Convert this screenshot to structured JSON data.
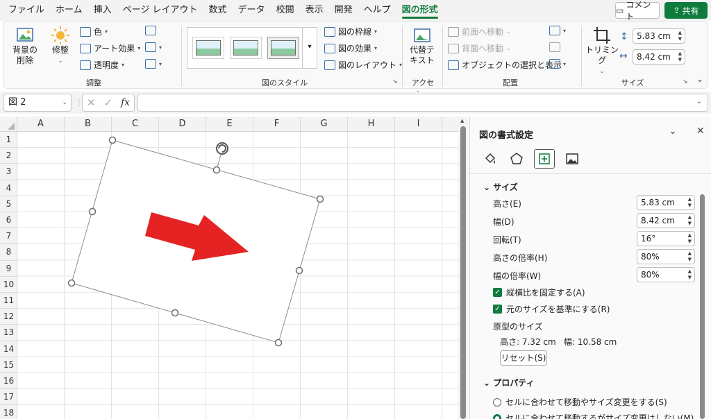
{
  "menu": {
    "tabs": [
      "ファイル",
      "ホーム",
      "挿入",
      "ページ レイアウト",
      "数式",
      "データ",
      "校閲",
      "表示",
      "開発",
      "ヘルプ",
      "図の形式"
    ],
    "active_tab": "図の形式",
    "comment_label": "コメント",
    "share_label": "共有"
  },
  "ribbon": {
    "adjust": {
      "remove_bg": "背景の\n削除",
      "corrections": "修整",
      "color": "色",
      "art_effects": "アート効果",
      "transparency": "透明度",
      "group_label": "調整"
    },
    "styles": {
      "border": "図の枠線",
      "effects": "図の効果",
      "layout": "図のレイアウト",
      "group_label": "図のスタイル"
    },
    "accessibility": {
      "alt_text": "代替テ\nキスト",
      "group_label": "アクセシ…"
    },
    "arrange": {
      "bring_forward": "前面へ移動",
      "send_backward": "背面へ移動",
      "selection_pane": "オブジェクトの選択と表示",
      "group_label": "配置"
    },
    "size": {
      "crop": "トリミング",
      "height": "5.83 cm",
      "width": "8.42 cm",
      "group_label": "サイズ"
    }
  },
  "formula_bar": {
    "name_box": "図 2",
    "fx": "fx",
    "content": ""
  },
  "sheet": {
    "columns": [
      "A",
      "B",
      "C",
      "D",
      "E",
      "F",
      "G",
      "H",
      "I"
    ],
    "rows": [
      "1",
      "2",
      "3",
      "4",
      "5",
      "6",
      "7",
      "8",
      "9",
      "10",
      "11",
      "12",
      "13",
      "14",
      "15",
      "16",
      "17",
      "18"
    ],
    "picture": {
      "rotation_deg": 16,
      "arrow_color": "#e52323"
    }
  },
  "pane": {
    "title": "図の書式設定",
    "size_section": "サイズ",
    "height_label": "高さ(E)",
    "height_value": "5.83 cm",
    "width_label": "幅(D)",
    "width_value": "8.42 cm",
    "rotation_label": "回転(T)",
    "rotation_value": "16°",
    "scale_h_label": "高さの倍率(H)",
    "scale_h_value": "80%",
    "scale_w_label": "幅の倍率(W)",
    "scale_w_value": "80%",
    "lock_aspect": "縦横比を固定する(A)",
    "relative_original": "元のサイズを基準にする(R)",
    "original_size_label": "原型のサイズ",
    "original_height": "高さ:   7.32 cm",
    "original_width": "幅:   10.58 cm",
    "reset_label": "リセット(S)",
    "properties_section": "プロパティ",
    "prop_option1": "セルに合わせて移動やサイズ変更をする(S)",
    "prop_option2": "セルに合わせて移動するがサイズ変更はしない(M)"
  },
  "colors": {
    "accent": "#0f7b3c",
    "arrow": "#e52323"
  }
}
